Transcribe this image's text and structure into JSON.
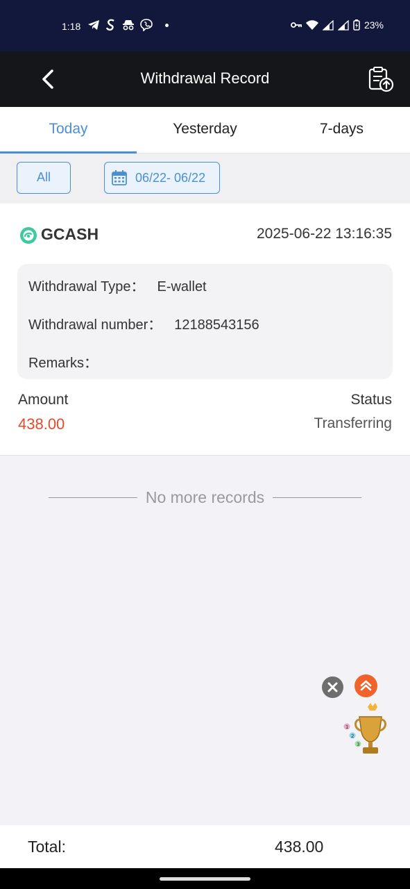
{
  "status_bar": {
    "time": "1:18",
    "battery": "23%"
  },
  "header": {
    "title": "Withdrawal Record"
  },
  "tabs": [
    {
      "label": "Today",
      "active": true
    },
    {
      "label": "Yesterday",
      "active": false
    },
    {
      "label": "7-days",
      "active": false
    }
  ],
  "filters": {
    "all_label": "All",
    "date_range": "06/22- 06/22"
  },
  "record": {
    "provider": "GCASH",
    "datetime": "2025-06-22 13:16:35",
    "type_label": "Withdrawal Type：",
    "type_value": "E-wallet",
    "number_label": "Withdrawal number：",
    "number_value": "12188543156",
    "remarks_label": "Remarks：",
    "amount_label": "Amount",
    "amount_value": "438.00",
    "status_label": "Status",
    "status_value": "Transferring"
  },
  "no_more": "No more records",
  "footer": {
    "total_label": "Total:",
    "total_value": "438.00"
  },
  "colors": {
    "accent": "#4a8fd4",
    "amount": "#e14b2d",
    "header_bg": "#151619",
    "status_bg": "#11183c"
  }
}
